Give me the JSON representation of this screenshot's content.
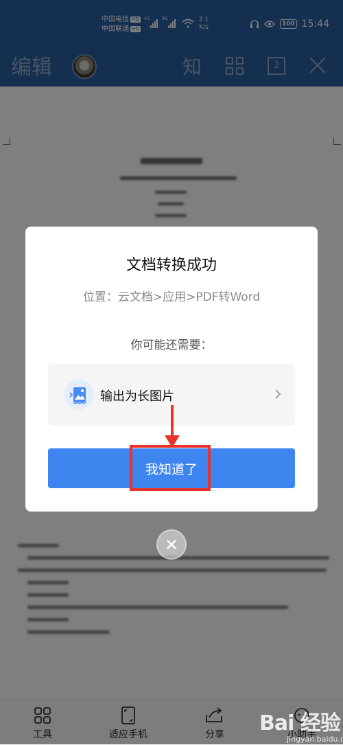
{
  "status_bar": {
    "carrier_1": "中国电信",
    "carrier_2": "中国联通",
    "hd_label": "HD",
    "network_label": "4G",
    "speed_value": "2.1",
    "speed_unit": "K/s",
    "battery": "100",
    "time": "15:44"
  },
  "toolbar": {
    "title": "编辑",
    "zhi_label": "知",
    "page_count": "2"
  },
  "bottom_bar": {
    "items": [
      {
        "label": "工具",
        "icon": "tools-grid-icon"
      },
      {
        "label": "适应手机",
        "icon": "fit-phone-icon"
      },
      {
        "label": "分享",
        "icon": "share-icon"
      },
      {
        "label": "小助手",
        "icon": "assistant-icon"
      }
    ]
  },
  "dialog": {
    "title": "文档转换成功",
    "location": "位置：云文档>应用>PDF转Word",
    "need_label": "你可能还需要：",
    "option_label": "输出为长图片",
    "option_icon": "long-image-icon",
    "confirm_button": "我知道了"
  },
  "watermark": {
    "logo": "Bai 经验",
    "url": "jingyan.baidu.com"
  },
  "colors": {
    "status_bar_bg": "#2a5fa3",
    "button_blue": "#3f85f0",
    "annotation_red": "#e8322a"
  }
}
